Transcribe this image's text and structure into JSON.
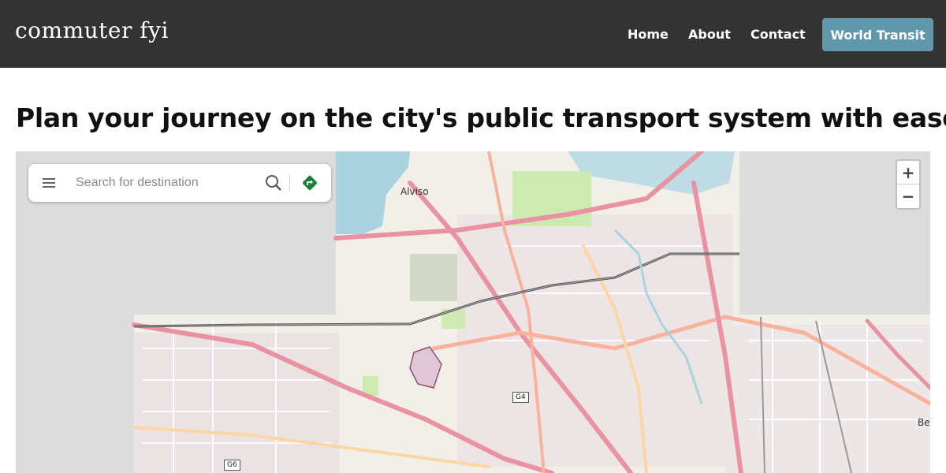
{
  "header": {
    "brand": "commuter fyi",
    "nav": {
      "home": "Home",
      "about": "About",
      "contact": "Contact"
    },
    "cta_label": "World Transit",
    "cta_color": "#6197ab",
    "bg_color": "#333333"
  },
  "main": {
    "headline": "Plan your journey on the city's public transport system with ease!"
  },
  "map": {
    "search": {
      "placeholder": "Search for destination",
      "value": ""
    },
    "icons": {
      "menu": "hamburger-menu-icon",
      "search": "magnifier-icon",
      "directions": "directions-arrow-icon"
    },
    "zoom": {
      "in": "+",
      "out": "−"
    },
    "labels": {
      "town": "Alviso",
      "edge_town": "Be"
    },
    "route_shields": {
      "g4": "G4",
      "g6": "G6"
    },
    "colors": {
      "directions": "#188038",
      "water": "#aad3df",
      "major_road": "#e892a2",
      "park": "#cdebb0"
    }
  }
}
